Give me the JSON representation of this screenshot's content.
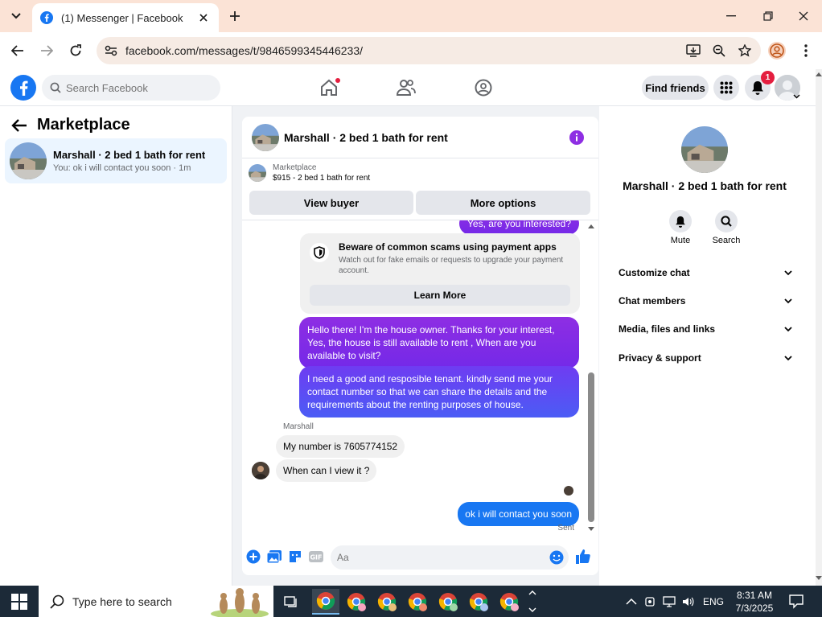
{
  "browser": {
    "tab_title": "(1) Messenger | Facebook",
    "url": "facebook.com/messages/t/9846599345446233/"
  },
  "fb": {
    "search_placeholder": "Search Facebook",
    "find_friends": "Find friends",
    "notification_count": "1"
  },
  "left": {
    "title": "Marketplace",
    "conversation": {
      "name": "Marshall · 2 bed 1 bath for rent",
      "preview": "You: ok i will contact you soon · 1m"
    }
  },
  "chat": {
    "title": "Marshall · 2 bed 1 bath for rent",
    "listing_category": "Marketplace",
    "listing_price": "$915 - 2 bed 1 bath for rent",
    "view_buyer": "View buyer",
    "more_options": "More options",
    "partial_message": "Yes, are you interested?",
    "scam_title": "Beware of common scams using payment apps",
    "scam_desc": "Watch out for fake emails or requests to upgrade your payment account.",
    "learn_more": "Learn More",
    "msg_out_1": "Hello there! I'm the house owner. Thanks for your interest, Yes, the house is still available to rent , When are you available to visit?",
    "msg_out_2": "I need a good and resposible tenant.  kindly send me your contact number so that we can share the details and the requirements about the renting purposes of house.",
    "sender_label": "Marshall",
    "msg_in_1": "My number is 7605774152",
    "msg_in_2": "When can I view it ?",
    "msg_out_3": "ok i will contact you soon",
    "status": "Sent",
    "composer_placeholder": "Aa"
  },
  "right": {
    "name": "Marshall · 2 bed 1 bath for rent",
    "mute": "Mute",
    "search": "Search",
    "sections": [
      "Customize chat",
      "Chat members",
      "Media, files and links",
      "Privacy & support"
    ]
  },
  "taskbar": {
    "search_placeholder": "Type here to search",
    "lang": "ENG",
    "time": "8:31 AM",
    "date": "7/3/2025"
  },
  "colors": {
    "fb_blue": "#1877f2",
    "accent_purple": "#8e2ee3",
    "notif_red": "#e41e3f",
    "taskbar": "#1c2a38"
  }
}
